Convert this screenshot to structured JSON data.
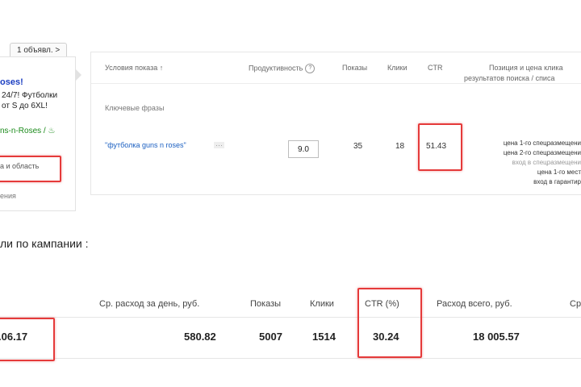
{
  "ad_preview": {
    "count_button": "1 объявл. >",
    "title": "oses!",
    "text_line1": "24/7! Футболки",
    "text_line2": "от S до 6XL!",
    "url": "ns-n-Roses / ♨",
    "region": "а и область",
    "more": "ения"
  },
  "stats_panel": {
    "headers": {
      "conditions": "Условия показа ↑",
      "productivity": "Продуктивность",
      "impressions": "Показы",
      "clicks": "Клики",
      "ctr": "CTR",
      "position_line1": "Позиция и цена клика",
      "position_line2": "результатов поиска / списа"
    },
    "group_label": "Ключевые фразы",
    "row": {
      "phrase": "\"футболка guns n roses\"",
      "dots": "···",
      "bid_value": "9.0",
      "impressions": "35",
      "clicks": "18",
      "ctr": "51.43"
    },
    "position_lines": [
      "цена 1-го спецразмещени",
      "цена 2-го спецразмещени",
      "вход в спецразмещени",
      "цена 1-го мест",
      "вход в гарантир"
    ]
  },
  "campaign_summary": {
    "title": "ли по кампании :",
    "headers": {
      "avg_daily": "Ср. расход за день, руб.",
      "impressions": "Показы",
      "clicks": "Клики",
      "ctr": "CTR (%)",
      "total_spend": "Расход всего, руб.",
      "cut": "Ср"
    },
    "row": {
      "date": ".06.17",
      "avg_daily": "580.82",
      "impressions": "5007",
      "clicks": "1514",
      "ctr": "30.24",
      "total_spend": "18 005.57"
    }
  },
  "colors": {
    "highlight": "#e53a3a",
    "link": "#1a5fc1",
    "ad_title": "#1a3dc1",
    "ad_url": "#1a8a1a"
  }
}
